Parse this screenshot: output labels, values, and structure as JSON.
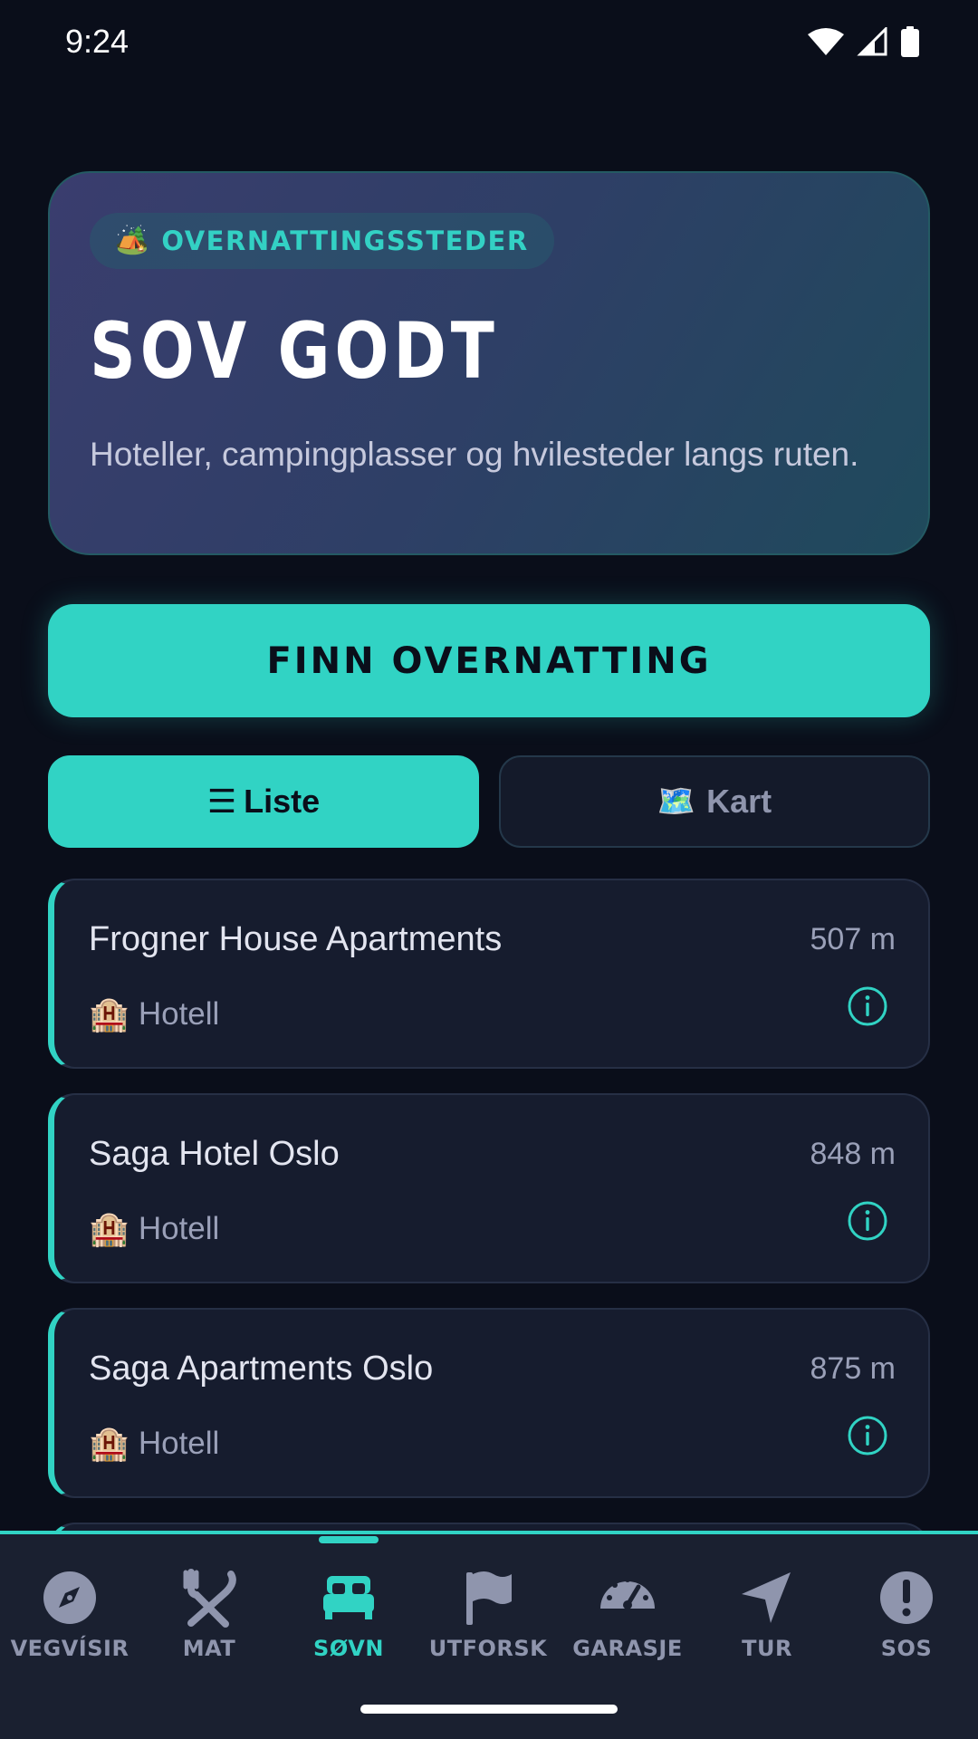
{
  "status": {
    "time": "9:24"
  },
  "hero": {
    "badge_icon": "🏕️",
    "badge_text": "OVERNATTINGSSTEDER",
    "title": "SOV GODT",
    "subtitle": "Hoteller, campingplasser og hvilesteder langs ruten."
  },
  "primary_button": {
    "label": "FINN OVERNATTING"
  },
  "view_toggle": {
    "list_icon": "☰",
    "list_label": "Liste",
    "map_icon": "🗺️",
    "map_label": "Kart",
    "active": "list"
  },
  "places": [
    {
      "name": "Frogner House Apartments",
      "type_icon": "🏨",
      "type": "Hotell",
      "distance": "507 m",
      "info_icon": "info-icon"
    },
    {
      "name": "Saga Hotel Oslo",
      "type_icon": "🏨",
      "type": "Hotell",
      "distance": "848 m",
      "info_icon": "info-icon"
    },
    {
      "name": "Saga Apartments Oslo",
      "type_icon": "🏨",
      "type": "Hotell",
      "distance": "875 m",
      "info_icon": "info-icon"
    }
  ],
  "nav": {
    "items": [
      {
        "label": "VEGVÍSIR",
        "icon": "compass-icon"
      },
      {
        "label": "MAT",
        "icon": "utensils-icon"
      },
      {
        "label": "SØVN",
        "icon": "bed-icon",
        "active": true
      },
      {
        "label": "UTFORSK",
        "icon": "flag-icon"
      },
      {
        "label": "GARASJE",
        "icon": "speedometer-icon"
      },
      {
        "label": "TUR",
        "icon": "navigation-arrow-icon"
      },
      {
        "label": "SOS",
        "icon": "alert-icon"
      }
    ]
  },
  "colors": {
    "accent": "#31d3c4",
    "background": "#0a0e1a",
    "card": "#161c2e",
    "nav_background": "#1a2030",
    "inactive": "#8f95ad"
  }
}
